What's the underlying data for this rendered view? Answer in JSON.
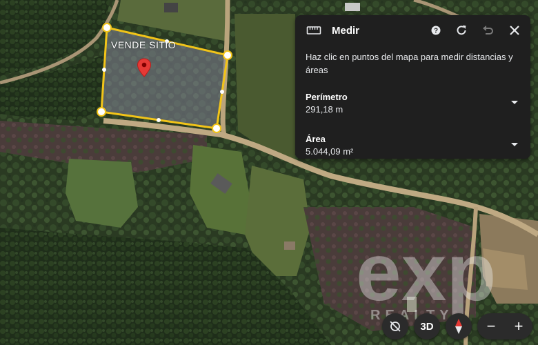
{
  "map": {
    "site_label": "VENDE SITIO",
    "watermark_main": "exp",
    "watermark_sub": "REALTY"
  },
  "measure_panel": {
    "title": "Medir",
    "description": "Haz clic en puntos del mapa para medir distancias y áreas",
    "perimeter": {
      "label": "Perímetro",
      "value": "291,18 m"
    },
    "area": {
      "label": "Área",
      "value": "5.044,09 m²"
    },
    "icons": [
      "ruler-icon",
      "help-icon",
      "refresh-icon",
      "undo-icon",
      "close-icon"
    ]
  },
  "controls": {
    "tilt_icon": "tilt-disabled-icon",
    "three_d_label": "3D",
    "compass_icon": "compass-icon",
    "zoom_out_label": "−",
    "zoom_in_label": "+"
  },
  "colors": {
    "measure_line": "#f2c418",
    "pin": "#e53935",
    "panel_bg": "#1f1f1f"
  }
}
